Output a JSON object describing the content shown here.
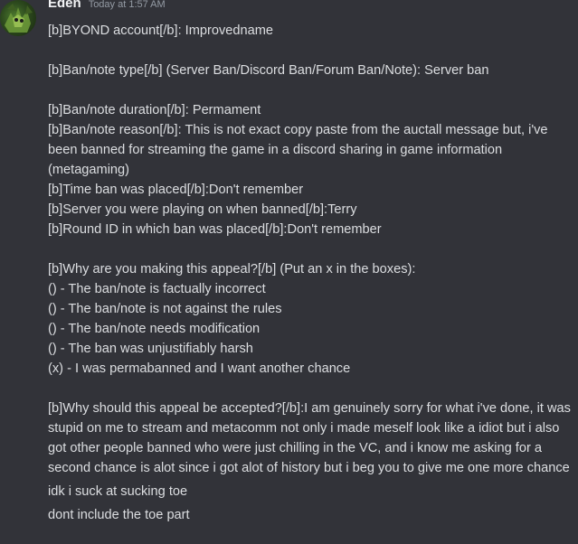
{
  "message": {
    "author": "Eden",
    "timestamp": "Today at 1:57 AM",
    "avatar_icon": "user-avatar-green-character"
  },
  "messages": [
    "[b]BYOND account[/b]: Improvedname\n\n[b]Ban/note type[/b] (Server Ban/Discord Ban/Forum Ban/Note): Server ban\n\n[b]Ban/note duration[/b]: Permament\n[b]Ban/note reason[/b]: This is not exact copy paste from the auctall message but, i've been banned for streaming the game in a discord sharing in game information (metagaming)\n[b]Time ban was placed[/b]:Don't remember\n[b]Server you were playing on when banned[/b]:Terry\n[b]Round ID in which ban was placed[/b]:Don't remember\n\n[b]Why are you making this appeal?[/b] (Put an x in the boxes):\n() - The ban/note is factually incorrect\n() - The ban/note is not against the rules\n() - The ban/note needs modification\n() - The ban was unjustifiably harsh\n(x) - I was permabanned and I want another chance\n\n[b]Why should this appeal be accepted?[/b]:I am genuinely sorry for what i've done, it was stupid on me to stream and metacomm not only i made meself look like a idiot but i also got other people banned who were just chilling in the VC, and i know me asking for a second chance is alot since i got alot of history but i beg you to give me one more chance",
    "idk i suck at sucking toe",
    "dont include the toe part"
  ],
  "colors": {
    "background": "#323339",
    "text": "#dcdee1",
    "username": "#f2f3f5",
    "timestamp": "#949ba4"
  }
}
